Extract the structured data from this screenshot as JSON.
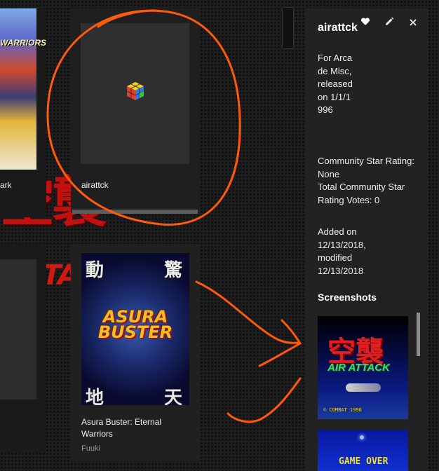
{
  "background": {
    "kanji": "空襲",
    "fragment": "TAC"
  },
  "cards": {
    "left_top": {
      "art_text": "WARRIORS",
      "label": "ark"
    },
    "airattck": {
      "title": "airattck",
      "progress": 1.0
    },
    "asura": {
      "title": "Asura Buster: Eternal Warriors",
      "publisher": "Fuuki",
      "art": {
        "logo": "ASURA BUSTER",
        "kanji_tl": "動",
        "kanji_tr": "驚",
        "kanji_bl": "地",
        "kanji_br": "天"
      }
    }
  },
  "details": {
    "title": "airattck",
    "icons": {
      "favorite": "heart-icon",
      "edit": "pencil-icon",
      "close": "close-icon"
    },
    "platform_line": "For Arcade Misc, released on 1/1/1996",
    "rating_line": "Community Star Rating: None",
    "votes_line": "Total Community Star Rating Votes: 0",
    "added_line": "Added on 12/13/2018, modified 12/13/2018",
    "screenshots_heading": "Screenshots",
    "screenshot1": {
      "kanji": "空襲",
      "subtitle": "AIR ATTACK",
      "footer": "© COMBAT 1996"
    },
    "screenshot2": {
      "text": "GAME OVER"
    }
  },
  "colors": {
    "annotation": "#ff5a0a",
    "panel_bg": "#222222",
    "kanji_red": "#c01010"
  }
}
